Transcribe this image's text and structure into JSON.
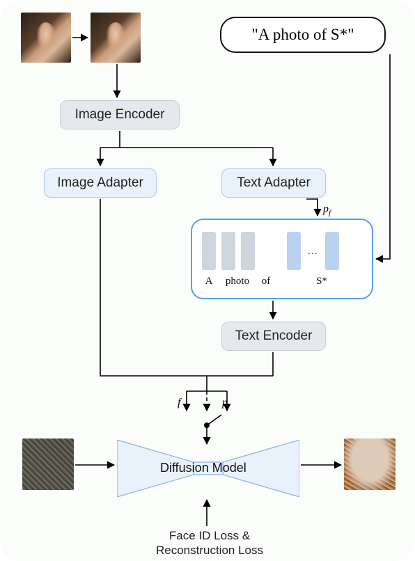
{
  "prompt_text": "\"A photo of S*\"",
  "blocks": {
    "image_encoder": "Image Encoder",
    "image_adapter": "Image Adapter",
    "text_adapter": "Text Adapter",
    "text_encoder": "Text Encoder",
    "diffusion": "Diffusion Model"
  },
  "token_labels": {
    "a": "A",
    "photo": "photo",
    "of": "of",
    "s": "S*"
  },
  "symbols": {
    "pf": "p",
    "pf_sub": "f",
    "f": "f",
    "p": "p"
  },
  "loss_text_line1": "Face ID Loss &",
  "loss_text_line2": "Reconstruction Loss",
  "icons": {
    "input_face_1": "face-photo",
    "input_face_2": "face-photo",
    "noisy_input": "noisy-image",
    "output_face": "denoised-face"
  }
}
